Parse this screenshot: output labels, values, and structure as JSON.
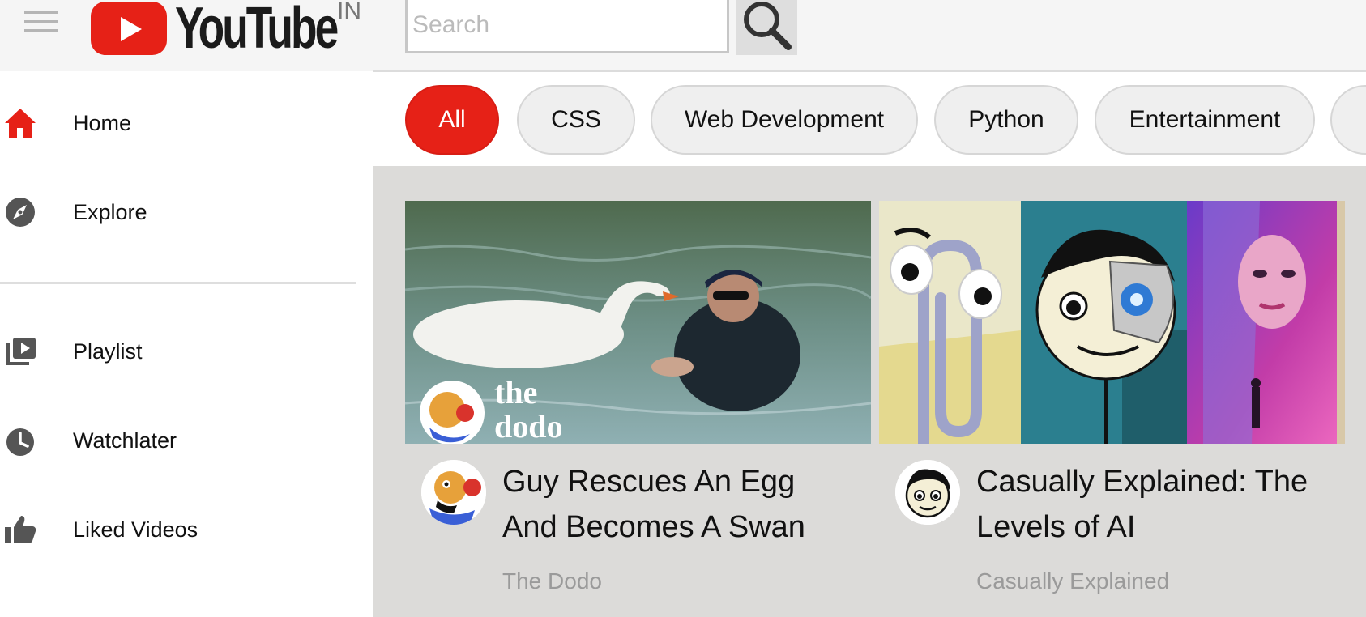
{
  "header": {
    "logo_text": "YouTube",
    "country_code": "IN",
    "search_placeholder": "Search",
    "menu_icon": "hamburger-menu-icon",
    "search_icon": "magnifier-icon"
  },
  "sidebar": {
    "items": [
      {
        "label": "Home",
        "icon": "home-icon",
        "active": true
      },
      {
        "label": "Explore",
        "icon": "compass-icon"
      },
      {
        "label": "Playlist",
        "icon": "playlist-icon"
      },
      {
        "label": "Watchlater",
        "icon": "clock-icon"
      },
      {
        "label": "Liked Videos",
        "icon": "thumbs-up-icon"
      }
    ]
  },
  "chips": [
    "All",
    "CSS",
    "Web Development",
    "Python",
    "Entertainment"
  ],
  "videos": [
    {
      "title": "Guy Rescues An Egg And Becomes A Swan",
      "channel": "The Dodo",
      "thumbnail_text": "the dodo"
    },
    {
      "title": "Casually Explained: The Levels of AI",
      "channel": "Casually Explained"
    }
  ],
  "colors": {
    "brand_red": "#e62117",
    "header_bg": "#f5f5f5",
    "content_bg": "#dcdbd9",
    "chip_bg": "#efefef",
    "channel_text": "#9a9a9a"
  }
}
